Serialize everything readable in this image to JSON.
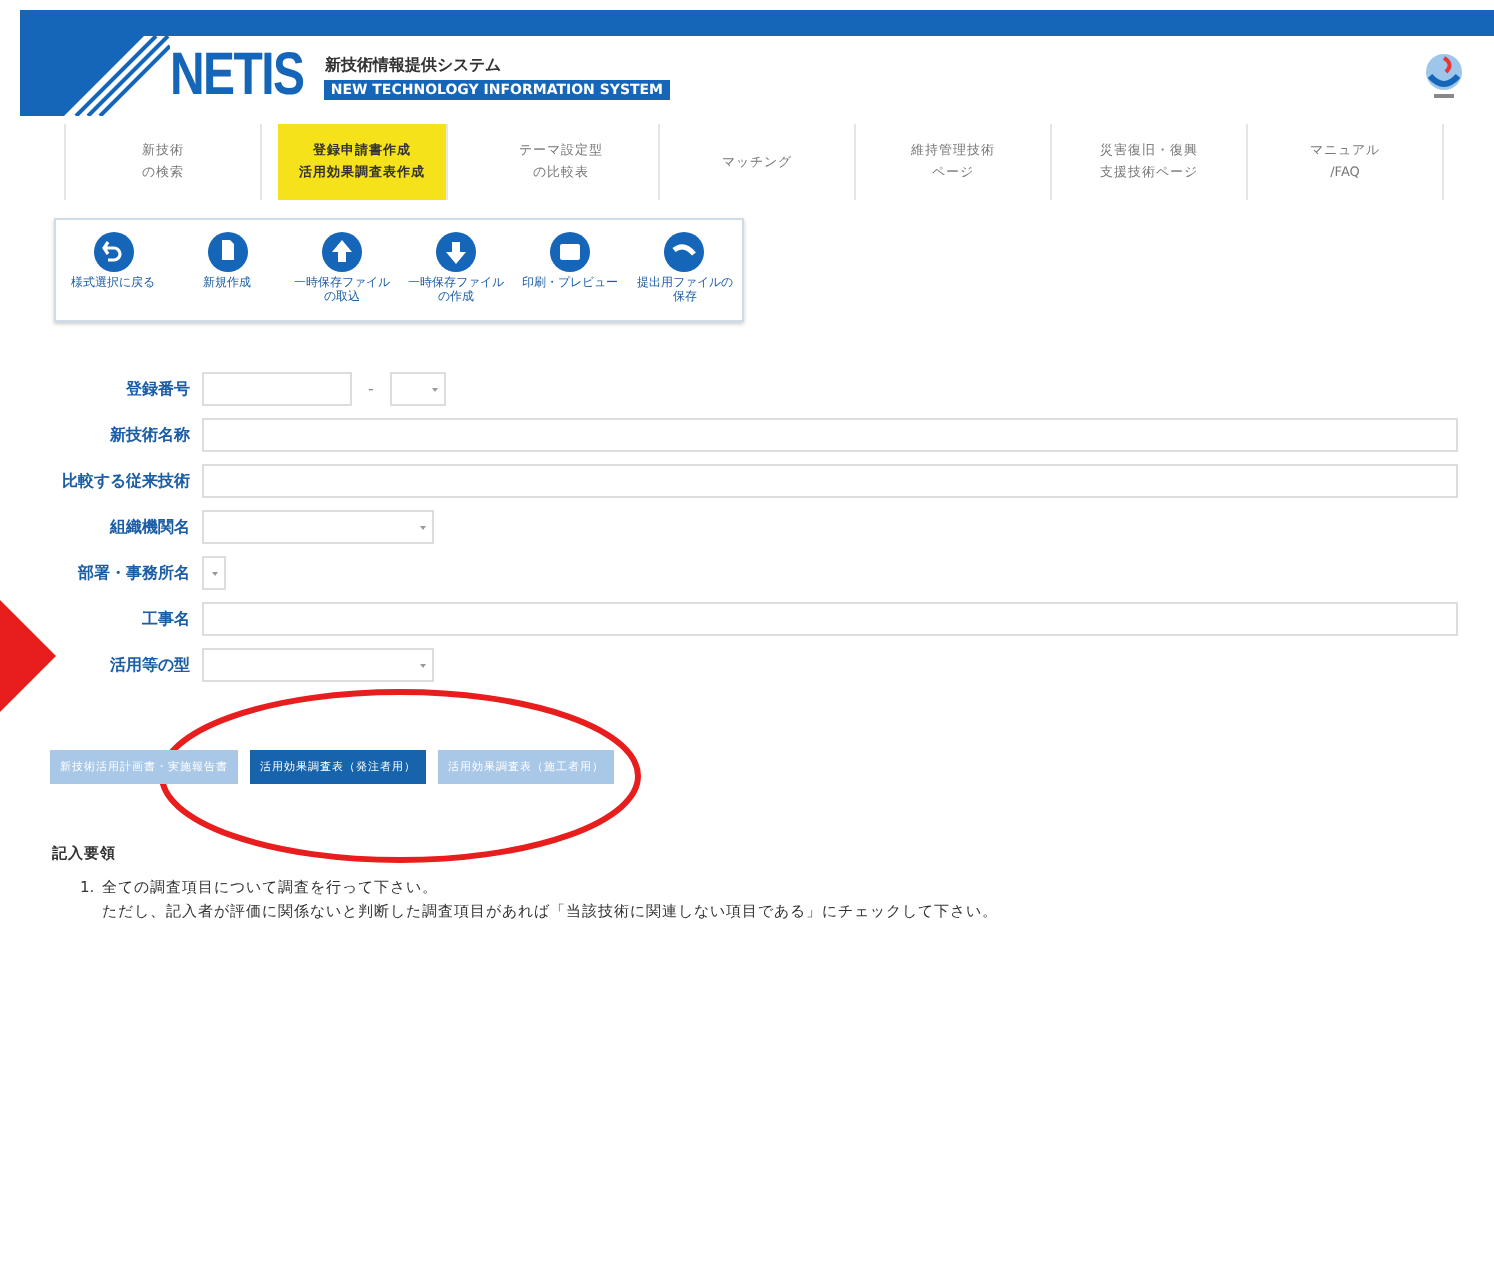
{
  "header": {
    "logo": "NETIS",
    "subtitle_ja": "新技術情報提供システム",
    "subtitle_en": "NEW TECHNOLOGY INFORMATION SYSTEM"
  },
  "nav": [
    {
      "lines": [
        "新技術",
        "の検索"
      ],
      "selected": false
    },
    {
      "lines": [
        "登録申請書作成",
        "活用効果調査表作成"
      ],
      "selected": true
    },
    {
      "lines": [
        "テーマ設定型",
        "の比較表"
      ],
      "selected": false
    },
    {
      "lines": [
        "マッチング"
      ],
      "selected": false
    },
    {
      "lines": [
        "維持管理技術",
        "ページ"
      ],
      "selected": false
    },
    {
      "lines": [
        "災害復旧・復興",
        "支援技術ページ"
      ],
      "selected": false
    },
    {
      "lines": [
        "マニュアル",
        "/FAQ"
      ],
      "selected": false
    }
  ],
  "toolbar": [
    {
      "label": "様式選択に戻る"
    },
    {
      "label": "新規作成"
    },
    {
      "label": "一時保存ファイルの取込"
    },
    {
      "label": "一時保存ファイルの作成"
    },
    {
      "label": "印刷・プレビュー"
    },
    {
      "label": "提出用ファイルの保存"
    }
  ],
  "form": [
    {
      "label": "登録番号",
      "kind": "code",
      "separator": "-"
    },
    {
      "label": "新技術名称",
      "kind": "text"
    },
    {
      "label": "比較する従来技術",
      "kind": "text"
    },
    {
      "label": "組織機関名",
      "kind": "select"
    },
    {
      "label": "部署・事務所名",
      "kind": "mini"
    },
    {
      "label": "工事名",
      "kind": "text"
    },
    {
      "label": "活用等の型",
      "kind": "select"
    }
  ],
  "form_tabs": [
    {
      "label": "新技術活用計画書・実施報告書",
      "selected": false
    },
    {
      "label": "活用効果調査表（発注者用）",
      "selected": true
    },
    {
      "label": "活用効果調査表（施工者用）",
      "selected": false
    }
  ],
  "notes": {
    "title": "記入要領",
    "items": [
      {
        "number": "1.",
        "lines": [
          "全ての調査項目について調査を行って下さい。",
          "ただし、記入者が評価に関係ないと判断した調査項目があれば「当該技術に関連しない項目である」にチェックして下さい。"
        ]
      }
    ]
  }
}
